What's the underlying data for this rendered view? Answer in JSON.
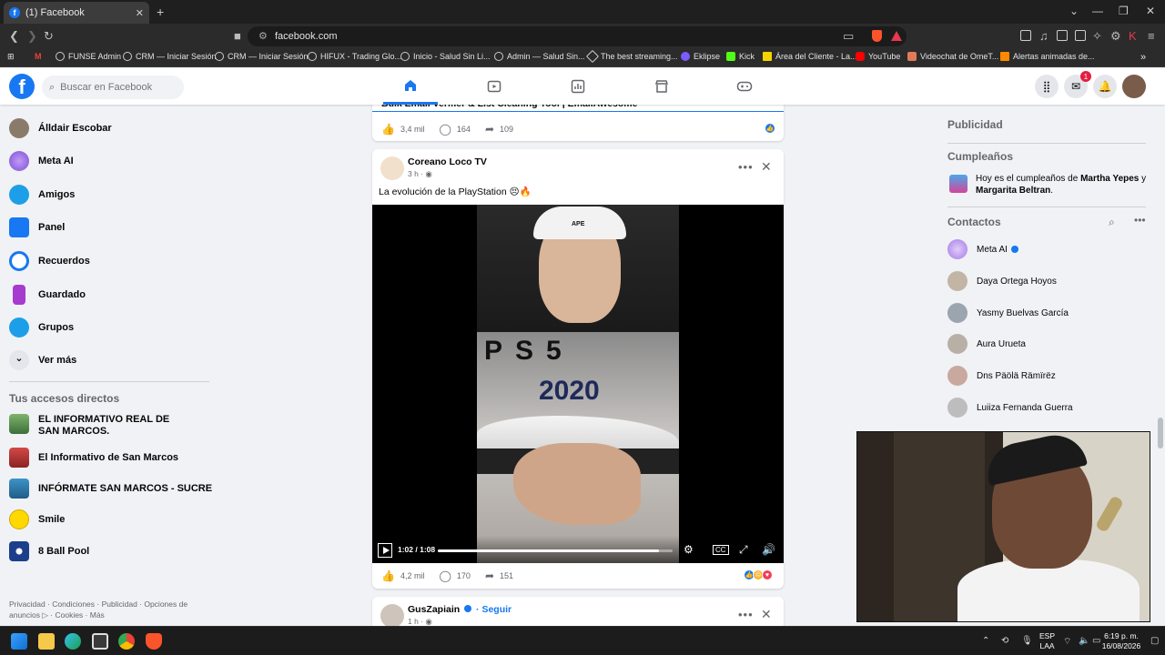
{
  "browser": {
    "tab_title": "(1) Facebook",
    "tab_close": "✕",
    "new_tab": "+",
    "url": "facebook.com",
    "bookmarks": [
      {
        "label": "FUNSE Admin"
      },
      {
        "label": "CRM — Iniciar Sesión"
      },
      {
        "label": "CRM — Iniciar Sesión"
      },
      {
        "label": "HIFUX - Trading Glo..."
      },
      {
        "label": "Inicio - Salud Sin Li..."
      },
      {
        "label": "Admin — Salud Sin..."
      },
      {
        "label": "The best streaming..."
      },
      {
        "label": "Eklipse"
      },
      {
        "label": "Kick"
      },
      {
        "label": "Área del Cliente - La..."
      },
      {
        "label": "YouTube"
      },
      {
        "label": "Videochat de OmeT..."
      },
      {
        "label": "Alertas animadas de..."
      }
    ],
    "bookmark_gmail": "M",
    "more": "»"
  },
  "fb": {
    "logo": "f",
    "search_placeholder": "Buscar en Facebook",
    "messenger_badge": "1",
    "sidebar": [
      {
        "label": "Álldair Escobar",
        "color": "#8a7a6a"
      },
      {
        "label": "Meta AI",
        "color": "#a57ae6"
      },
      {
        "label": "Amigos",
        "color": "#1c9fe8"
      },
      {
        "label": "Panel",
        "color": "#1877f2"
      },
      {
        "label": "Recuerdos",
        "color": "#1877f2"
      },
      {
        "label": "Guardado",
        "color": "#a63bd0"
      },
      {
        "label": "Grupos",
        "color": "#1c9fe8"
      }
    ],
    "see_more": "Ver más",
    "see_more_chevron": "⌄",
    "shortcuts_title": "Tus accesos directos",
    "shortcuts": [
      {
        "label": "EL INFORMATIVO REAL DE SAN MARCOS."
      },
      {
        "label": "El Informativo de San Marcos"
      },
      {
        "label": "INFÓRMATE SAN MARCOS - SUCRE"
      },
      {
        "label": "Smile"
      },
      {
        "label": "8 Ball Pool"
      }
    ],
    "footer": "Privacidad · Condiciones · Publicidad · Opciones de anuncios ▷ · Cookies · Más"
  },
  "feed": {
    "top_post": {
      "title_fragment": "Bulk Email Verifier & List Cleaning Tool | EmailAwesome",
      "likes": "3,4 mil",
      "comments": "164",
      "shares": "109"
    },
    "post": {
      "author": "Coreano Loco TV",
      "time": "3 h ·",
      "text": "La evolución de la PlayStation 😣🔥",
      "video_brand": "APE",
      "video_logo": "PS5",
      "video_year": "2020",
      "video_time": "1:02 / 1:08",
      "video_progress": 0.94,
      "likes": "4,2 mil",
      "comments": "170",
      "shares": "151"
    },
    "next_post": {
      "author": "GusZapiain",
      "follow": "· Seguir",
      "time": "1 h ·"
    },
    "more_options": "•••",
    "close": "✕"
  },
  "right": {
    "ads_title": "Publicidad",
    "birthdays_title": "Cumpleaños",
    "birthday_prefix": "Hoy es el cumpleaños de ",
    "birthday_name1": "Martha Yepes",
    "birthday_and": " y ",
    "birthday_name2": "Margarita Beltran",
    "birthday_suffix": ".",
    "contacts_title": "Contactos",
    "contacts": [
      {
        "name": "Meta AI"
      },
      {
        "name": "Daya Ortega Hoyos"
      },
      {
        "name": "Yasmy Buelvas García"
      },
      {
        "name": "Aura Urueta"
      },
      {
        "name": "Dns Päölä Rämïrëz"
      },
      {
        "name": "Luiiza Fernanda Guerra"
      }
    ]
  },
  "taskbar": {
    "lang1": "ESP",
    "lang2": "LAA",
    "time": "6:19 p. m.",
    "date": "16/08/2026"
  }
}
